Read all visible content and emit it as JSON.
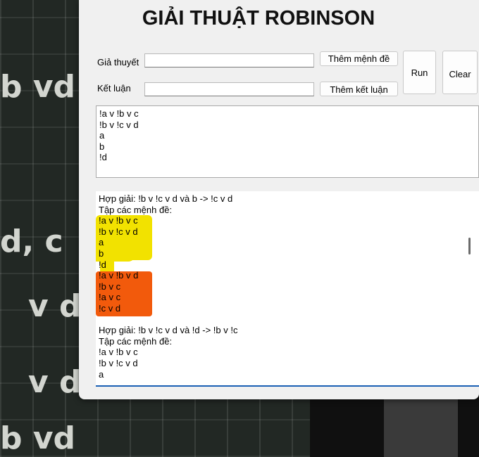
{
  "window": {
    "title": "GIẢI THUẬT ROBINSON"
  },
  "form": {
    "hypothesis_label": "Giả thuyết",
    "hypothesis_value": "",
    "conclusion_label": "Kết luận",
    "conclusion_value": "",
    "add_clause_button": "Thêm mệnh đề",
    "add_conclusion_button": "Thêm kết luận",
    "run_button": "Run",
    "clear_button": "Clear"
  },
  "clauses_box": {
    "lines": [
      "!a v !b v c",
      "!b v !c v d",
      "a",
      "b",
      "!d"
    ]
  },
  "output_box": {
    "lines": [
      "Hợp giải: !b v !c v d và b -> !c v d",
      "Tập các mệnh đề:",
      "!a v !b v c",
      "!b v !c v d",
      "a",
      "b",
      "!d",
      "!a v !b v d",
      "!b v c",
      "!a v c",
      "!c v d",
      "",
      "Hợp giải: !b v !c v d và !d -> !b v !c",
      "Tập các mệnh đề:",
      "!a v !b v c",
      "!b v !c v d",
      "a"
    ],
    "highlight_colors": {
      "yellow": "#f2e200",
      "orange": "#f25a0c"
    }
  },
  "background": {
    "chalk_marks": [
      "b vd",
      "d, c",
      "v d",
      "v d",
      "b vd"
    ]
  }
}
